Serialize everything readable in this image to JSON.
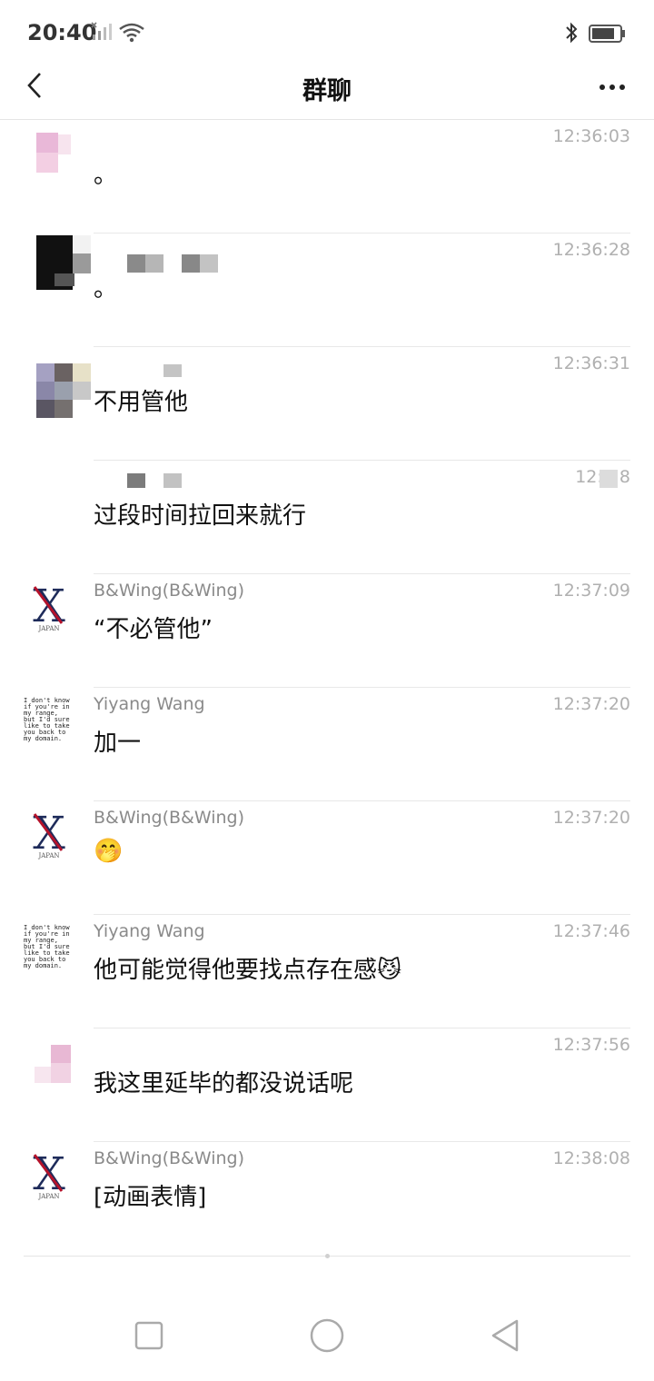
{
  "status_bar": {
    "time": "20:40",
    "icons": [
      "signal-icon",
      "wifi-icon",
      "bluetooth-icon",
      "battery-icon"
    ]
  },
  "header": {
    "title": "群聊",
    "back_icon": "back-arrow-icon",
    "more_icon": "more-dots-icon"
  },
  "messages": [
    {
      "sender": "",
      "time": "12:36:03",
      "text": "。"
    },
    {
      "sender": "",
      "time": "12:36:28",
      "text": "。"
    },
    {
      "sender": "",
      "time": "12:36:31",
      "text": "不用管他"
    },
    {
      "sender": "",
      "time": "12:3 8",
      "text": "过段时间拉回来就行"
    },
    {
      "sender": "B&Wing(B&Wing)",
      "time": "12:37:09",
      "text": "“不必管他”"
    },
    {
      "sender": "Yiyang Wang",
      "time": "12:37:20",
      "text": "加一"
    },
    {
      "sender": "B&Wing(B&Wing)",
      "time": "12:37:20",
      "text": "🤭"
    },
    {
      "sender": "Yiyang Wang",
      "time": "12:37:46",
      "text": "他可能觉得他要找点存在感😼"
    },
    {
      "sender": "",
      "time": "12:37:56",
      "text": "我这里延毕的都没说话呢"
    },
    {
      "sender": "B&Wing(B&Wing)",
      "time": "12:38:08",
      "text": "[动画表情]"
    }
  ],
  "avatars": {
    "x_japan": {
      "letter": "X",
      "caption": "JAPAN"
    },
    "yiyang": {
      "lines": [
        "I don't know",
        "if you're in",
        "my range,",
        "but I'd sure",
        "like to take",
        "you back to",
        "my domain."
      ]
    }
  },
  "system_nav": {
    "icons": [
      "recent-apps-icon",
      "home-icon",
      "back-icon"
    ]
  },
  "colors": {
    "text": "#111111",
    "sender": "#8a8a8a",
    "timestamp": "#b0b0b0",
    "divider": "#e8e8e8"
  }
}
